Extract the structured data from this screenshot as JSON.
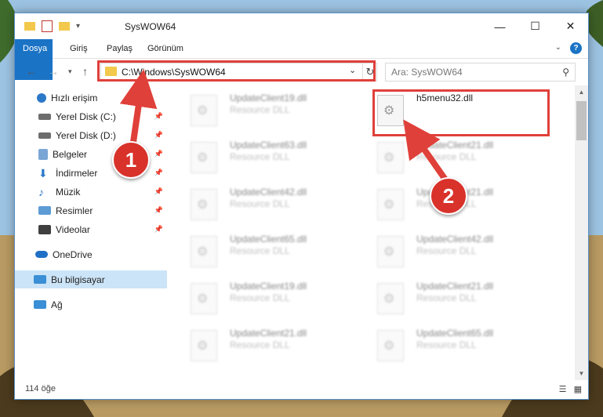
{
  "window": {
    "title": "SysWOW64",
    "minimize": "—",
    "maximize": "☐",
    "close": "✕"
  },
  "ribbon": {
    "tabs": [
      "Dosya",
      "Giriş",
      "Paylaş",
      "Görünüm"
    ],
    "help": "?"
  },
  "address": {
    "path": "C:\\Windows\\SysWOW64",
    "search_placeholder": "Ara: SysWOW64"
  },
  "nav": {
    "items": [
      {
        "label": "Hızlı erişim",
        "icon": "star-icon",
        "color": "#2b78c8"
      },
      {
        "label": "Yerel Disk (C:)",
        "icon": "drive-icon",
        "color": "#6d6d6d"
      },
      {
        "label": "Yerel Disk (D:)",
        "icon": "drive-icon",
        "color": "#6d6d6d"
      },
      {
        "label": "Belgeler",
        "icon": "documents-icon",
        "color": "#7aa6d6"
      },
      {
        "label": "İndirmeler",
        "icon": "download-icon",
        "color": "#2b78c8"
      },
      {
        "label": "Müzik",
        "icon": "music-icon",
        "color": "#2b78c8"
      },
      {
        "label": "Resimler",
        "icon": "pictures-icon",
        "color": "#5d9bd5"
      },
      {
        "label": "Videolar",
        "icon": "videos-icon",
        "color": "#3f3f3f"
      },
      {
        "label": "OneDrive",
        "icon": "cloud-icon",
        "color": "#1f6fc5"
      },
      {
        "label": "Bu bilgisayar",
        "icon": "computer-icon",
        "color": "#3a8fd6"
      },
      {
        "label": "Ağ",
        "icon": "network-icon",
        "color": "#3a8fd6"
      }
    ]
  },
  "files": {
    "left": [
      {
        "name": "UpdateClient19.dll",
        "desc": "Resource DLL"
      },
      {
        "name": "UpdateClient63.dll",
        "desc": "Resource DLL"
      },
      {
        "name": "UpdateClient42.dll",
        "desc": "Resource DLL"
      },
      {
        "name": "UpdateClient65.dll",
        "desc": "Resource DLL"
      },
      {
        "name": "UpdateClient19.dll",
        "desc": "Resource DLL"
      },
      {
        "name": "UpdateClient21.dll",
        "desc": "Resource DLL"
      }
    ],
    "right": [
      {
        "name": "h5menu32.dll",
        "desc": ""
      },
      {
        "name": "UpdateClient21.dll",
        "desc": "Resource DLL"
      },
      {
        "name": "UpdateClient21.dll",
        "desc": "Resource DLL"
      },
      {
        "name": "UpdateClient42.dll",
        "desc": "Resource DLL"
      },
      {
        "name": "UpdateClient21.dll",
        "desc": "Resource DLL"
      },
      {
        "name": "UpdateClient65.dll",
        "desc": "Resource DLL"
      }
    ]
  },
  "status": {
    "count": "114 öğe"
  },
  "annotations": {
    "badge1": "1",
    "badge2": "2"
  }
}
